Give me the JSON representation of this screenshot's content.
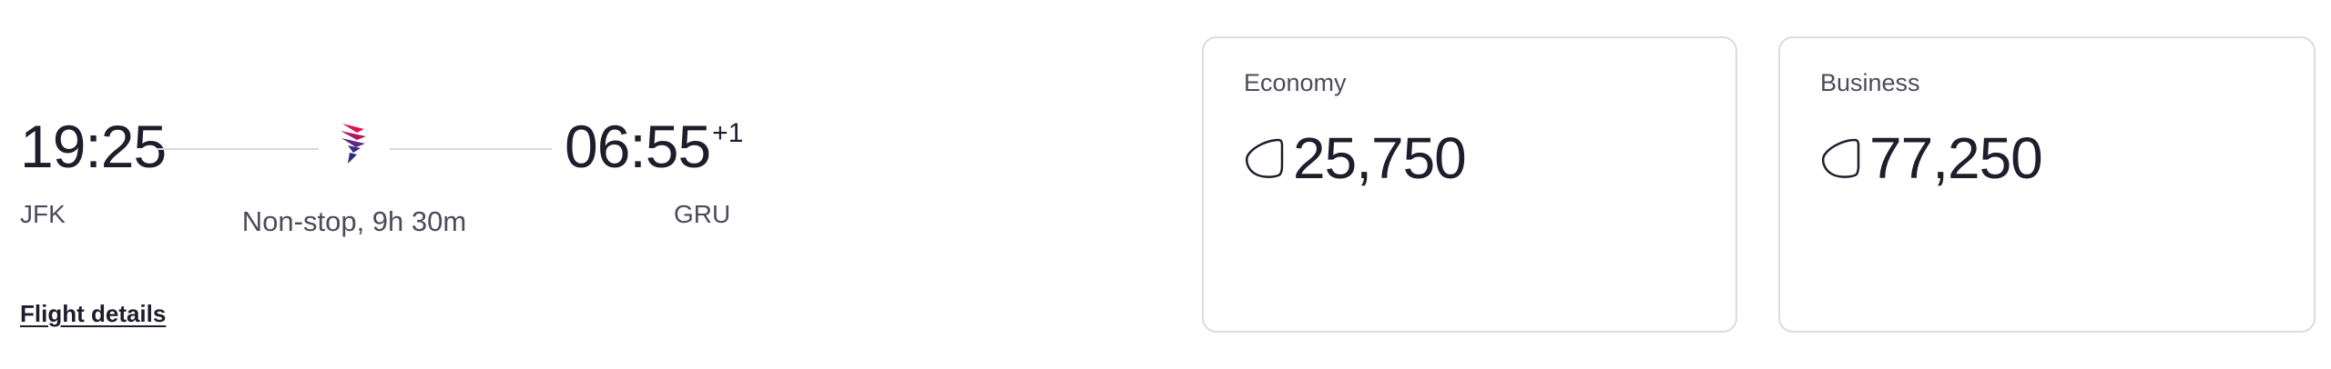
{
  "flight": {
    "departure_time": "19:25",
    "arrival_time": "06:55",
    "day_offset": "+1",
    "origin": "JFK",
    "destination": "GRU",
    "duration": "Non-stop, 9h 30m",
    "details_link": "Flight details",
    "airline_logo_icon": "latam-airline-logo-icon"
  },
  "fares": [
    {
      "cabin": "Economy",
      "amount": "25,750",
      "icon": "points-icon"
    },
    {
      "cabin": "Business",
      "amount": "77,250",
      "icon": "points-icon"
    }
  ],
  "colors": {
    "text_primary": "#1f1d2b",
    "text_secondary": "#4d4b5a",
    "border": "#dcdbe0",
    "logo_purple": "#5b2a86",
    "logo_red": "#e0114f"
  }
}
